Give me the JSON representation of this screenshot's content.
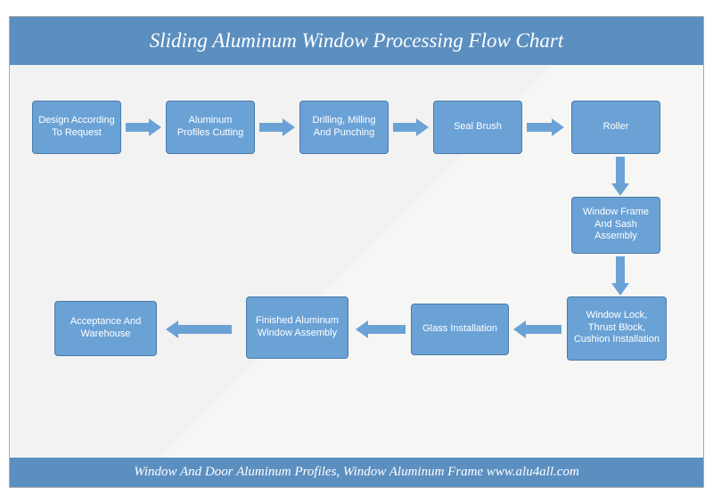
{
  "header": {
    "title": "Sliding Aluminum Window Processing Flow Chart"
  },
  "footer": {
    "text": "Window And Door Aluminum Profiles, Window Aluminum Frame www.alu4all.com"
  },
  "nodes": {
    "n1": "Design According To Request",
    "n2": "Aluminum Profiles Cutting",
    "n3": "Drilling, Milling And Punching",
    "n4": "Seal Brush",
    "n5": "Roller",
    "n6": "Window Frame And Sash Assembly",
    "n7": "Window Lock, Thrust Block, Cushion Installation",
    "n8": "Glass Installation",
    "n9": "Finished Aluminum Window Assembly",
    "n10": "Acceptance And Warehouse"
  },
  "flow_order": [
    "n1",
    "n2",
    "n3",
    "n4",
    "n5",
    "n6",
    "n7",
    "n8",
    "n9",
    "n10"
  ]
}
